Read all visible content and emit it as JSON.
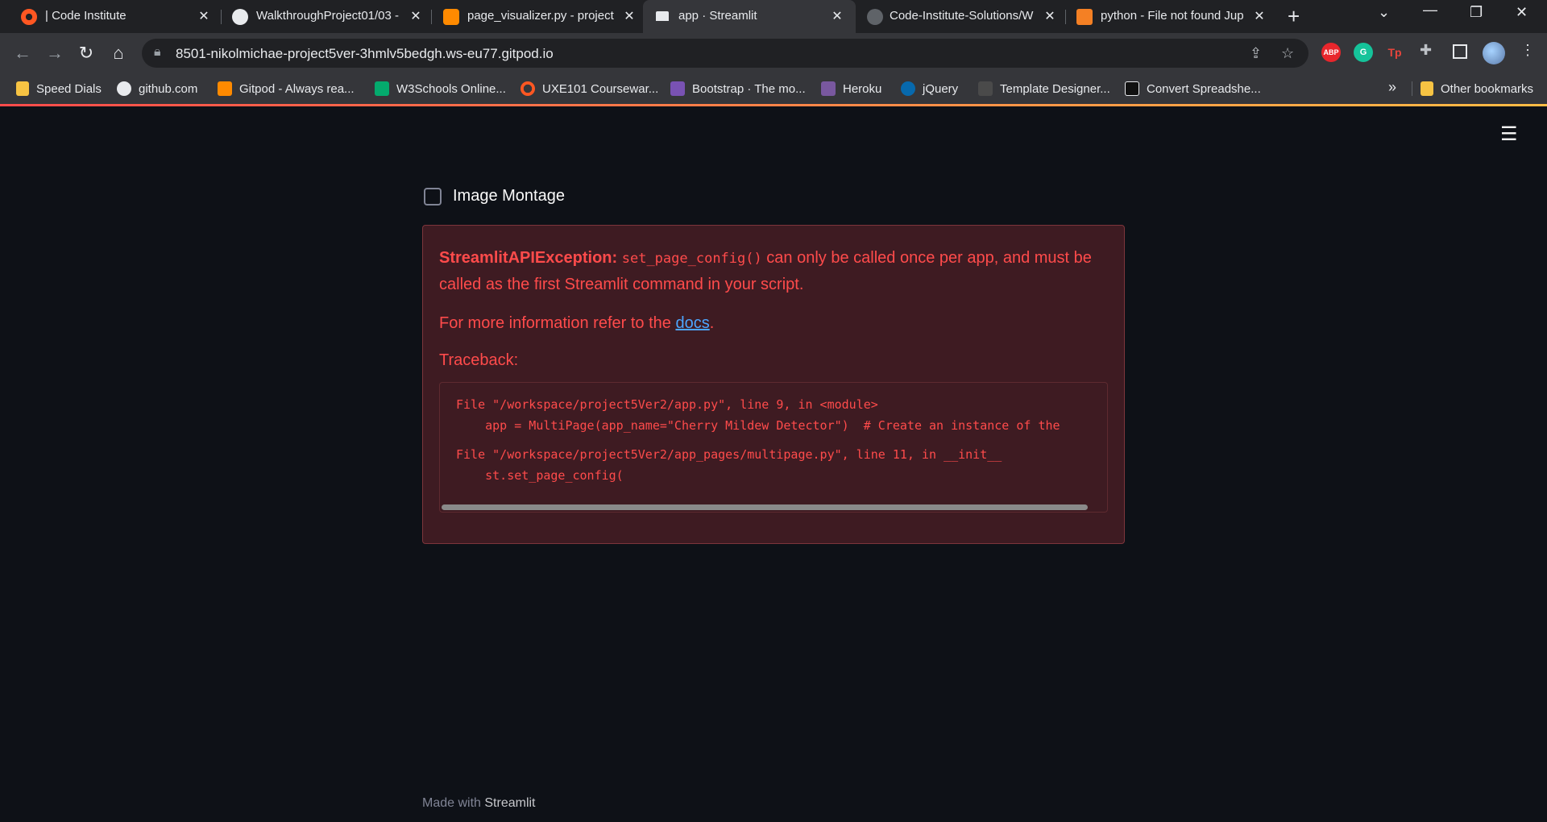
{
  "browser": {
    "tabs": [
      {
        "title": "| Code Institute",
        "active": false
      },
      {
        "title": "WalkthroughProject01/03 -",
        "active": false
      },
      {
        "title": "page_visualizer.py - project",
        "active": false
      },
      {
        "title": "app · Streamlit",
        "active": true
      },
      {
        "title": "Code-Institute-Solutions/W",
        "active": false
      },
      {
        "title": "python - File not found Jup",
        "active": false
      }
    ],
    "url": "8501-nikolmichae-project5ver-3hmlv5bedgh.ws-eu77.gitpod.io",
    "extensions": [
      "ABP",
      "G",
      "Tp"
    ],
    "bookmarks": [
      "Speed Dials",
      "github.com",
      "Gitpod - Always rea...",
      "W3Schools Online...",
      "UXE101 Coursewar...",
      "Bootstrap · The mo...",
      "Heroku",
      "jQuery",
      "Template Designer...",
      "Convert Spreadshe..."
    ],
    "other_bookmarks": "Other bookmarks",
    "overflow": "»"
  },
  "app": {
    "checkbox_label": "Image Montage",
    "error": {
      "exception_name": "StreamlitAPIException:",
      "code_fn": "set_page_config()",
      "message_rest": " can only be called once per app, and must be called as the first Streamlit command in your script.",
      "info_prefix": "For more information refer to the ",
      "info_link": "docs",
      "info_suffix": ".",
      "traceback_label": "Traceback:",
      "traceback": [
        "File \"/workspace/project5Ver2/app.py\", line 9, in <module>",
        "    app = MultiPage(app_name=\"Cherry Mildew Detector\")  # Create an instance of the",
        "File \"/workspace/project5Ver2/app_pages/multipage.py\", line 11, in __init__",
        "    st.set_page_config("
      ]
    },
    "footer_prefix": "Made with ",
    "footer_brand": "Streamlit"
  },
  "colors": {
    "background": "#0e1117",
    "error_text": "#ff4b4b",
    "error_bg": "#3e1b22",
    "link": "#4da6ff"
  }
}
